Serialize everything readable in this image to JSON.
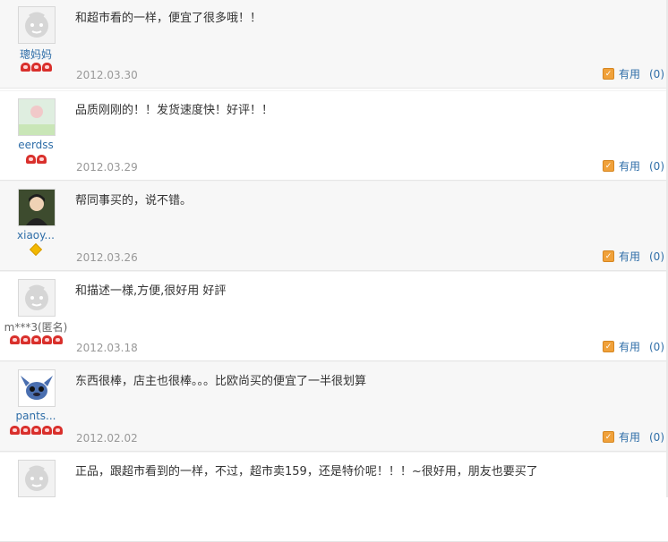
{
  "reviews": [
    {
      "nickname": "璁妈妈",
      "content": "和超市看的一样，便宜了很多哦！！",
      "date": "2012.03.30",
      "useful_label": "有用",
      "useful_count": "(0)",
      "rank": [
        "heart",
        "heart",
        "heart"
      ],
      "avatar": "default-avatar"
    },
    {
      "nickname": "eerdss",
      "content": "品质刚刚的！！发货速度快！好评！！",
      "date": "2012.03.29",
      "useful_label": "有用",
      "useful_count": "(0)",
      "rank": [
        "heart",
        "heart"
      ],
      "avatar": "user-photo"
    },
    {
      "nickname": "xiaoy...",
      "content": "帮同事买的，说不错。",
      "date": "2012.03.26",
      "useful_label": "有用",
      "useful_count": "(0)",
      "rank": [
        "diamond"
      ],
      "avatar": "user-photo"
    },
    {
      "nickname": "m***3(匿名)",
      "content": "和描述一様,方便,很好用  好評",
      "date": "2012.03.18",
      "useful_label": "有用",
      "useful_count": "(0)",
      "rank": [
        "heart",
        "heart",
        "heart",
        "heart",
        "heart"
      ],
      "avatar": "default-avatar"
    },
    {
      "nickname": "pants...",
      "content": "东西很棒，店主也很棒。。。比欧尚买的便宜了一半很划算",
      "date": "2012.02.02",
      "useful_label": "有用",
      "useful_count": "(0)",
      "rank": [
        "heart",
        "heart",
        "heart",
        "heart",
        "heart"
      ],
      "avatar": "stitch-avatar"
    },
    {
      "nickname": "",
      "content": "正品，跟超市看到的一样，不过，超市卖159，还是特价呢！！！~很好用，朋友也要买了",
      "date": "",
      "useful_label": "",
      "useful_count": "",
      "rank": [],
      "avatar": "default-avatar"
    }
  ],
  "colors": {
    "link": "#2f6ea8",
    "date": "#999999",
    "alt_bg": "#f7f7f7"
  }
}
